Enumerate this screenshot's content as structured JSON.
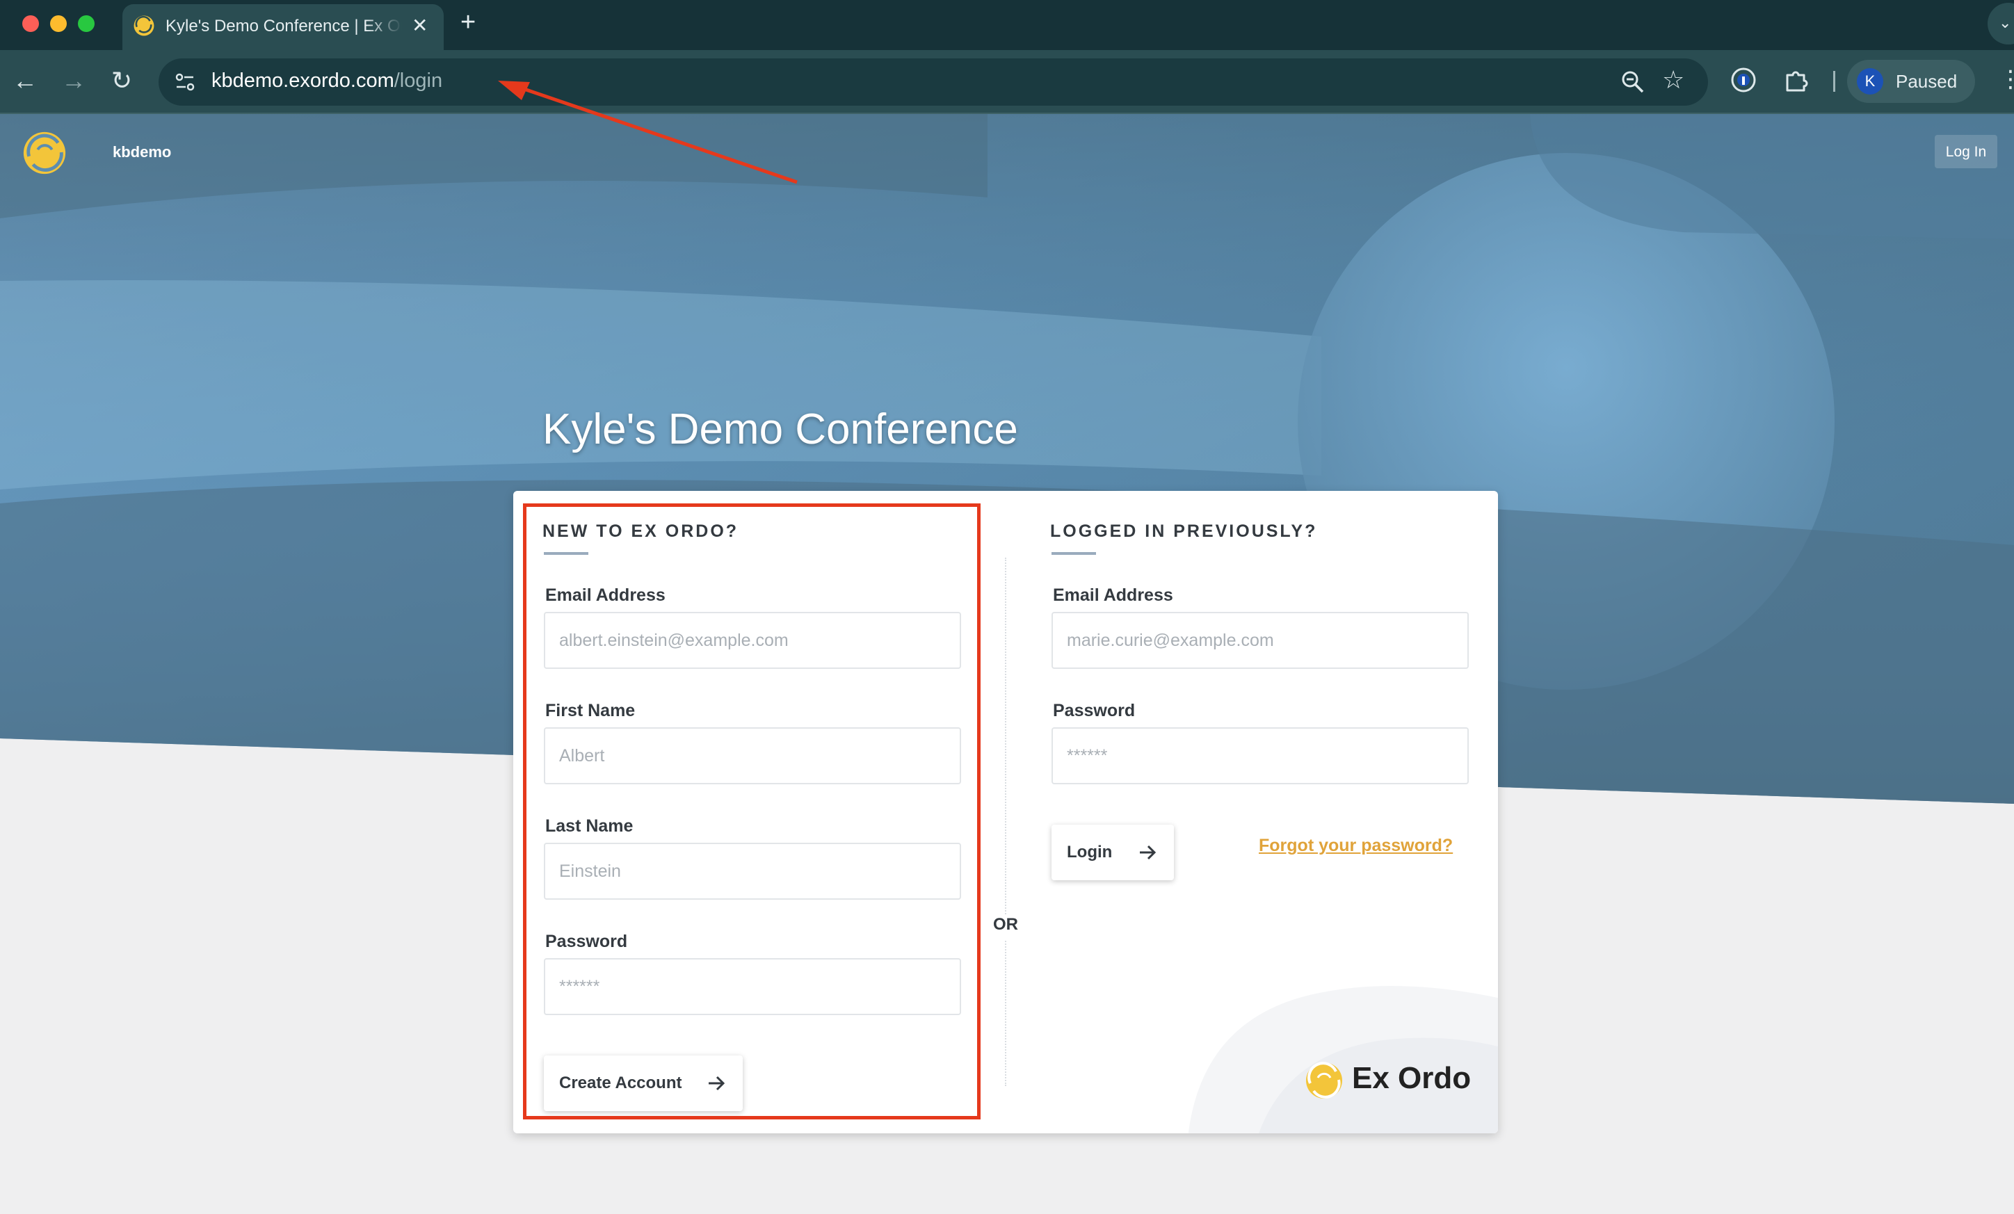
{
  "browser": {
    "tab": {
      "title": "Kyle's Demo Conference | Ex Ordo",
      "close_glyph": "✕"
    },
    "new_tab_glyph": "+",
    "tab_search_glyph": "⌄",
    "nav": {
      "back_glyph": "←",
      "forward_glyph": "→",
      "reload_glyph": "↻"
    },
    "address": {
      "host": "kbdemo.exordo.com",
      "path": "/login"
    },
    "star_glyph": "☆",
    "profile": {
      "initial": "K",
      "status": "Paused"
    },
    "menu_glyph": "⋮"
  },
  "site": {
    "brand": "kbdemo",
    "login_label": "Log In",
    "title": "Kyle's Demo Conference"
  },
  "new_account": {
    "heading": "NEW TO EX ORDO?",
    "email_label": "Email Address",
    "email_placeholder": "albert.einstein@example.com",
    "first_name_label": "First Name",
    "first_name_placeholder": "Albert",
    "last_name_label": "Last Name",
    "last_name_placeholder": "Einstein",
    "password_label": "Password",
    "password_placeholder": "******",
    "submit_label": "Create Account"
  },
  "separator": "OR",
  "existing_account": {
    "heading": "LOGGED IN PREVIOUSLY?",
    "email_label": "Email Address",
    "email_placeholder": "marie.curie@example.com",
    "password_label": "Password",
    "password_placeholder": "******",
    "submit_label": "Login",
    "forgot_label": "Forgot your password?"
  },
  "footer_brand": "Ex Ordo",
  "colors": {
    "chrome_dark": "#163238",
    "chrome_toolbar": "#2a4d52",
    "hero_blue": "#6fa7c9",
    "hero_dark": "#4f7188",
    "accent_gold": "#e0a33a",
    "logo_yellow": "#f3c53a",
    "annotation_red": "#e5391c"
  }
}
